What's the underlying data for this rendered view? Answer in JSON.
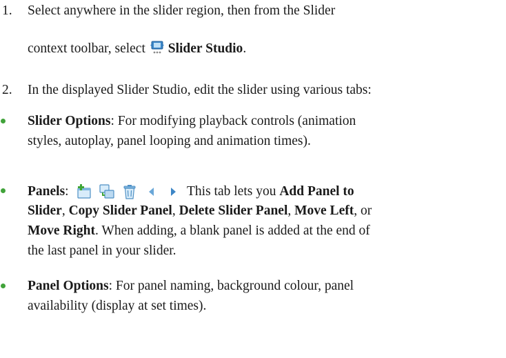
{
  "steps": [
    {
      "number": "1.",
      "line1": "Select anywhere in the slider region, then from the Slider",
      "line2_prefix": "context toolbar, select",
      "button_label": "Slider Studio",
      "line2_suffix": ".",
      "icon": "slider-studio-icon"
    },
    {
      "number": "2.",
      "text": "In the displayed Slider Studio, edit the slider using various tabs:"
    }
  ],
  "tabs": [
    {
      "title": "Slider Options",
      "line1_rest": ": For modifying playback controls (animation",
      "line2": "styles, autoplay, panel looping and animation times)."
    },
    {
      "title": "Panels",
      "colon": ":",
      "icons": [
        "add-panel-icon",
        "copy-panel-icon",
        "delete-panel-icon",
        "move-left-icon",
        "move-right-icon"
      ],
      "line1_rest": "This tab lets you",
      "action_add": "Add Panel to",
      "action_add_2": "Slider",
      "sep1": ",",
      "action_copy": "Copy Slider Panel",
      "sep2": ",",
      "action_delete": "Delete Slider Panel",
      "sep3": ",",
      "action_left": "Move Left",
      "sep4": ", or",
      "action_right": "Move Right",
      "line3_rest": ". When adding, a blank panel is added at the end of",
      "line4": "the last panel in your slider."
    },
    {
      "title": "Panel Options",
      "line1_rest": ": For panel naming, background colour, panel",
      "line2": "availability (display at set times)."
    }
  ],
  "colors": {
    "bullet": "#41a33a",
    "text": "#1a1a1a"
  }
}
